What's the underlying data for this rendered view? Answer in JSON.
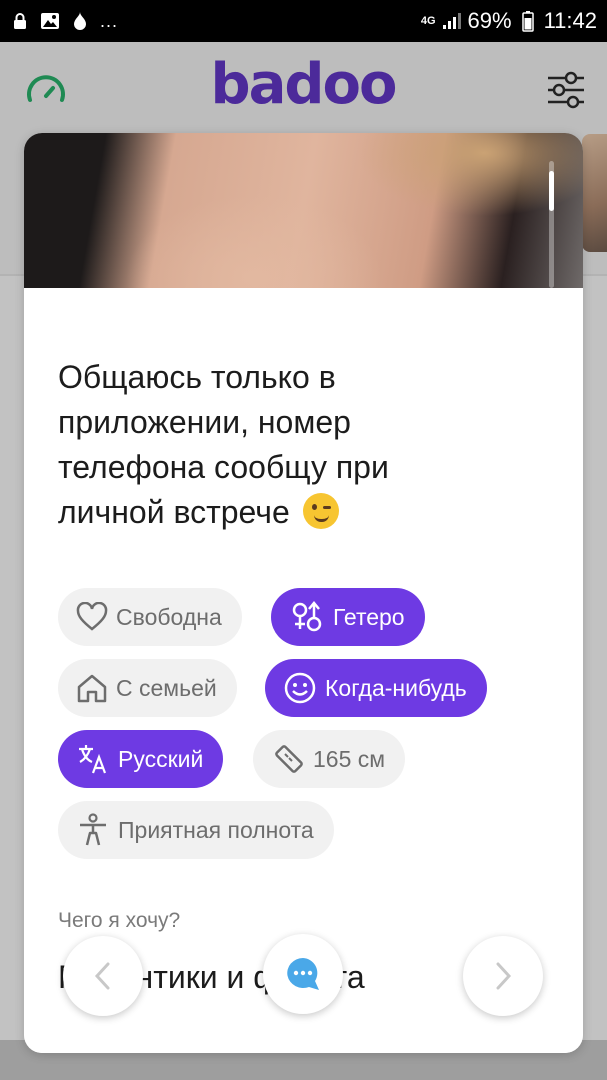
{
  "status_bar": {
    "network": "4G",
    "battery": "69%",
    "time": "11:42",
    "dots": "..."
  },
  "header": {
    "logo": "badoo"
  },
  "profile": {
    "bio": "Общаюсь только в приложении, номер телефона сообщу при личной встрече",
    "chips": [
      {
        "label": "Свободна",
        "icon": "heart-icon",
        "style": "light"
      },
      {
        "label": "Гетеро",
        "icon": "hetero-icon",
        "style": "purple"
      },
      {
        "label": "С семьей",
        "icon": "home-icon",
        "style": "light"
      },
      {
        "label": "Когда-нибудь",
        "icon": "smile-icon",
        "style": "purple"
      },
      {
        "label": "Русский",
        "icon": "translate-icon",
        "style": "purple"
      },
      {
        "label": "165 см",
        "icon": "ruler-icon",
        "style": "light"
      },
      {
        "label": "Приятная полнота",
        "icon": "body-icon",
        "style": "light"
      }
    ],
    "wants_label": "Чего я хочу?",
    "wants_value": "Романтики и флирта"
  },
  "colors": {
    "accent": "#6e3ae3",
    "logo": "#4c2a9a",
    "speed_icon": "#1f8a53",
    "chat_bubble": "#4aa8e8"
  }
}
